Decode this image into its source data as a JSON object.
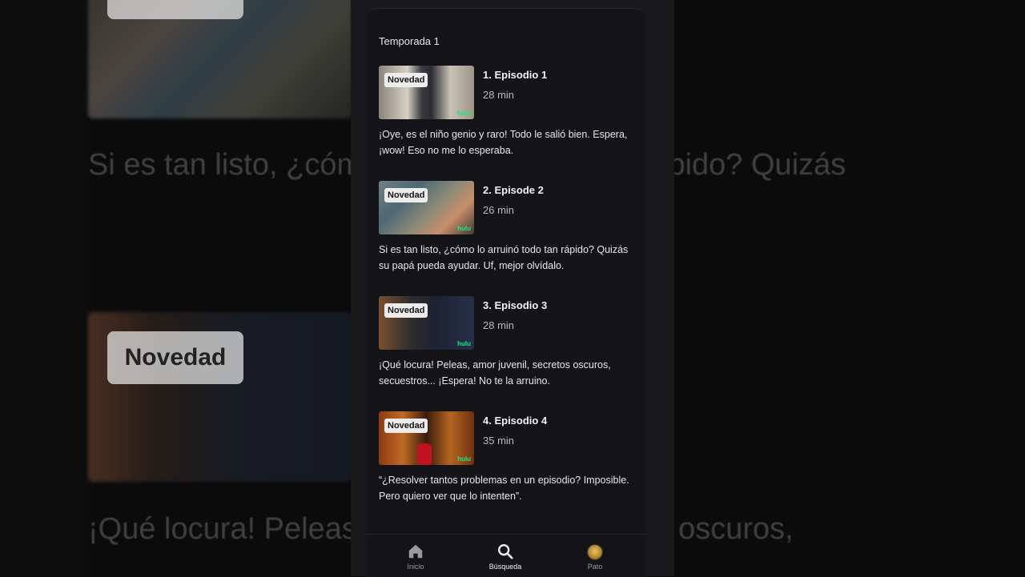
{
  "background": {
    "badge": "Novedad",
    "text_line_1": "Si es tan listo, ¿cómo lo arruinó todo tan rápido? Quizás",
    "text_line_2": "¡Qué locura! Peleas, amor juvenil, secretos oscuros,"
  },
  "season": {
    "label": "Temporada 1"
  },
  "episodes": [
    {
      "badge": "Novedad",
      "watermark": "hulu",
      "title": "1. Episodio 1",
      "duration": "28 min",
      "description": "¡Oye, es el niño genio y raro! Todo le salió bien. Espera, ¡wow! Eso no me lo esperaba."
    },
    {
      "badge": "Novedad",
      "watermark": "hulu",
      "title": "2. Episode 2",
      "duration": "26 min",
      "description": "Si es tan listo, ¿cómo lo arruinó todo tan rápido? Quizás su papá pueda ayudar. Uf, mejor olvídalo."
    },
    {
      "badge": "Novedad",
      "watermark": "hulu",
      "title": "3. Episodio 3",
      "duration": "28 min",
      "description": "¡Qué locura! Peleas, amor juvenil, secretos oscuros, secuestros... ¡Espera! No te la arruino."
    },
    {
      "badge": "Novedad",
      "watermark": "hulu",
      "title": "4. Episodio 4",
      "duration": "35 min",
      "description": "“¿Resolver tantos problemas en un episodio? Imposible. Pero quiero ver que lo intenten”."
    }
  ],
  "nav": {
    "items": [
      {
        "label": "Inicio",
        "icon": "home-icon",
        "active": false
      },
      {
        "label": "Búsqueda",
        "icon": "search-icon",
        "active": true
      },
      {
        "label": "Pato",
        "icon": "avatar",
        "active": false
      }
    ]
  },
  "colors": {
    "background": "#0b0b0c",
    "panel": "#141418",
    "text": "#f2f2f2",
    "muted": "#b9b9b9",
    "hulu_green": "#1ce783"
  }
}
